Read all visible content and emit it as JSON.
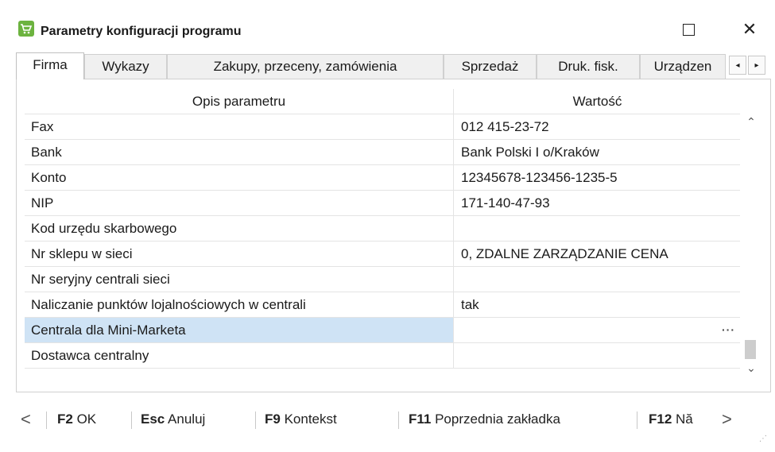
{
  "window": {
    "title": "Parametry konfiguracji programu",
    "maximize_label": "□",
    "close_label": "✕"
  },
  "tabs": [
    {
      "label": "Firma",
      "active": true
    },
    {
      "label": "Wykazy"
    },
    {
      "label": "Zakupy, przeceny, zamówienia"
    },
    {
      "label": "Sprzedaż"
    },
    {
      "label": "Druk. fisk."
    },
    {
      "label": "Urządzen"
    }
  ],
  "tab_scroll": {
    "left": "◂",
    "right": "▸"
  },
  "grid": {
    "headers": {
      "description": "Opis parametru",
      "value": "Wartość"
    },
    "rows": [
      {
        "label": "Fax",
        "value": "012 415-23-72"
      },
      {
        "label": "Bank",
        "value": "Bank Polski I o/Kraków"
      },
      {
        "label": "Konto",
        "value": "12345678-123456-1235-5"
      },
      {
        "label": "NIP",
        "value": "171-140-47-93"
      },
      {
        "label": "Kod urzędu skarbowego",
        "value": ""
      },
      {
        "label": "Nr sklepu w sieci",
        "value": "0, ZDALNE ZARZĄDZANIE CENA"
      },
      {
        "label": "Nr seryjny centrali sieci",
        "value": ""
      },
      {
        "label": "Naliczanie punktów lojalnościowych w centrali",
        "value": "tak"
      },
      {
        "label": "Centrala dla Mini-Marketa",
        "value": "",
        "selected": true,
        "ellipsis": "···"
      },
      {
        "label": "Dostawca centralny",
        "value": ""
      }
    ]
  },
  "scrollbar": {
    "up": "⌃",
    "down": "⌄"
  },
  "footer": {
    "prev_arrow": "<",
    "next_arrow": ">",
    "items": [
      {
        "key": "F2",
        "label": "OK"
      },
      {
        "key": "Esc",
        "label": "Anuluj"
      },
      {
        "key": "F9",
        "label": "Kontekst"
      },
      {
        "key": "F11",
        "label": "Poprzednia zakładka"
      },
      {
        "key": "F12",
        "label": "Nă"
      }
    ]
  },
  "colors": {
    "selected_row": "#cfe3f5",
    "app_icon": "#6cb33f"
  }
}
